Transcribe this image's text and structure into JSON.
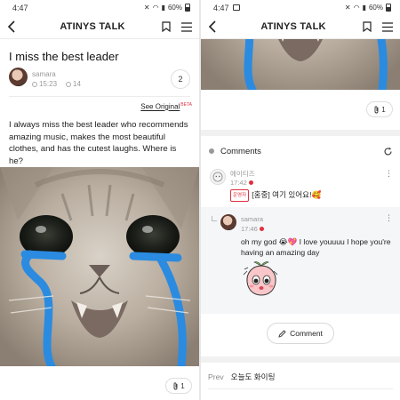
{
  "status_bar": {
    "time": "4:47",
    "battery": "60%"
  },
  "app": {
    "title": "ATINYS TALK"
  },
  "post": {
    "title": "I miss the best leader",
    "author": "samara",
    "time": "15:23",
    "views": "14",
    "comment_count": "2",
    "see_original": "See Original",
    "beta": "BETA",
    "body": "I always miss the best leader who recommends amazing music, makes the most beautiful clothes, and has the cutest laughs. Where is he?",
    "attachment_count": "1"
  },
  "comments_section": {
    "label": "Comments",
    "comments": [
      {
        "name": "에이티즈",
        "time": "17:42",
        "tag": "운영자",
        "text": "[홍중] 여기 있어요!🥰"
      },
      {
        "name": "samara",
        "time": "17:46",
        "text": "oh my god 😭💖 I love youuuu I hope you're having an amazing day"
      }
    ],
    "comment_button": "Comment"
  },
  "navigation": {
    "prev_label": "Prev",
    "prev_title": "오늘도 화이팅"
  },
  "colors": {
    "accent_red": "#e0303f",
    "line_blue": "#2a8be0"
  },
  "icons": [
    "back-arrow-icon",
    "bookmark-icon",
    "menu-icon",
    "paperclip-icon",
    "refresh-icon",
    "pencil-icon",
    "kebab-icon"
  ]
}
